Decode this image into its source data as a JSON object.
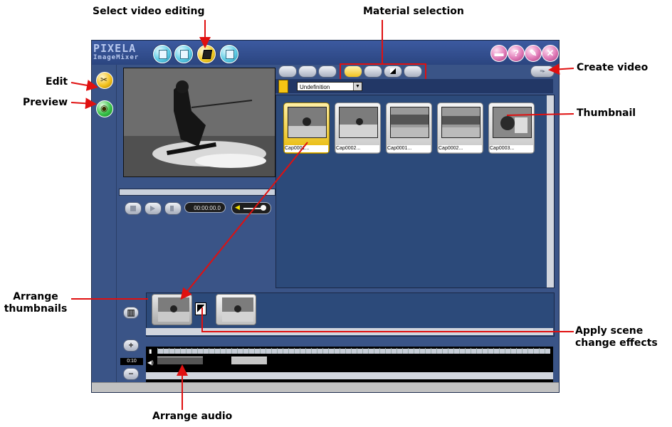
{
  "callouts": {
    "select_video_editing": "Select video editing",
    "material_selection": "Material selection",
    "edit": "Edit",
    "preview": "Preview",
    "create_video": "Create video",
    "thumbnail": "Thumbnail",
    "arrange_thumbnails": "Arrange thumbnails",
    "apply_scene_change_effects": "Apply scene change effects",
    "arrange_audio": "Arrange audio"
  },
  "app": {
    "logo_line1": "PIXELA",
    "logo_line2": "ImageMixer",
    "mode_buttons": [
      "capture-icon",
      "album-icon",
      "video-editing-icon",
      "output-icon"
    ],
    "active_mode": "video-editing",
    "system_buttons": [
      "minimize-icon",
      "help-icon",
      "settings-icon",
      "close-icon"
    ]
  },
  "sidebar": {
    "edit_icon": "scissors-icon",
    "preview_icon": "eye-icon"
  },
  "player": {
    "timecode": "00:00:00.0",
    "volume_level": 0.75,
    "controls": [
      "stop-icon",
      "play-icon",
      "pause-icon"
    ]
  },
  "material_toolbar": {
    "left_buttons": [
      "new-icon",
      "open-icon",
      "save-icon"
    ],
    "material_buttons": [
      "video-material-icon",
      "audio-material-icon",
      "effect-material-icon",
      "title-material-icon"
    ],
    "active_material": "video-material-icon",
    "create_video_button": "≡▸"
  },
  "folder": {
    "selected": "Undefinition"
  },
  "thumbnails": [
    {
      "label": "Cap0001...",
      "selected": true
    },
    {
      "label": "Cap0002...",
      "selected": false
    },
    {
      "label": "Cap0001...",
      "selected": false
    },
    {
      "label": "Cap0002...",
      "selected": false
    },
    {
      "label": "Cap0003...",
      "selected": false
    }
  ],
  "timeline": {
    "zoom": "0:10",
    "zoom_in": "+",
    "zoom_out": "−"
  },
  "colors": {
    "panel": "#3a5487",
    "accent": "#f4c21e",
    "annotation": "#e01010"
  }
}
